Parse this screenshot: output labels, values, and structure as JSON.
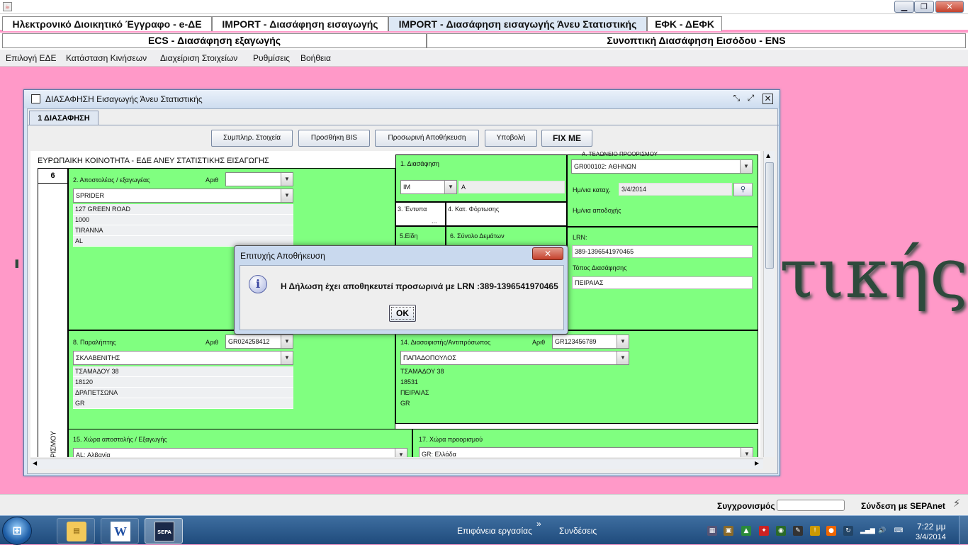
{
  "app": {
    "tabs_row1": [
      "Ηλεκτρονικό Διοικητικό Έγγραφο - e-ΔΕ",
      "IMPORT - Διασάφηση εισαγωγής",
      "IMPORT - Διασάφηση εισαγωγής Άνευ Στατιστικής",
      "ΕΦΚ - ΔΕΦΚ"
    ],
    "tabs_row2": [
      "ECS - Διασάφηση εξαγωγής",
      "Συνοπτική Διασάφηση Εισόδου - ENS"
    ],
    "selected_tab": "IMPORT - Διασάφηση εισαγωγής Άνευ Στατιστικής",
    "menu": [
      "Επιλογή ΕΔΕ",
      "Κατάσταση Κινήσεων",
      "Διαχείριση Στοιχείων",
      "Ρυθμίσεις",
      "Βοήθεια"
    ],
    "window_controls": [
      "minimize-icon",
      "restore-icon",
      "close-icon"
    ]
  },
  "background_word": "τικής",
  "frame": {
    "title": "ΔΙΑΣΑΦΗΣΗ Εισαγωγής Άνευ Στατιστικής",
    "tab": "1 ΔΙΑΣΑΦΗΣΗ",
    "buttons": [
      "Συμπληρ. Στοιχεία",
      "Προσθήκη BIS",
      "Προσωρινή Αποθήκευση",
      "Υποβολή",
      "FIX ME"
    ]
  },
  "form": {
    "header": "ΕΥΡΩΠΑΙΚΗ ΚΟΙΝΟΤΗΤΑ - ΕΔΕ ΑΝΕΥ ΣΤΑΤΙΣΤΙΚΗΣ ΕΙΣΑΓΩΓΗΣ",
    "col_number": "6",
    "side_label": "Α ΠΡΟΟΡΙΣΜΟΥ",
    "top_cut_label": "Α. ΤΕΛΩΝΕΙΟ ΠΡΟΟΡΙΣΜΟΥ",
    "box2": {
      "label": "2. Αποστολέας / εξαγωγέας",
      "arith": "Αριθ",
      "arith_value": "",
      "name": "SPRIDER",
      "lines": [
        "127 GREEN ROAD",
        "1000",
        "TIRANNA",
        "AL"
      ]
    },
    "box1": {
      "label": "1. Διασάφηση",
      "type": "IM",
      "sub": "A"
    },
    "box3": {
      "label": "3. Έντυπα",
      "value": "..."
    },
    "box4": {
      "label": "4. Κατ. Φόρτωσης"
    },
    "box5": {
      "label": "5.Είδη"
    },
    "box6": {
      "label": "6. Σύνολο Δεμάτων"
    },
    "boxA": {
      "office": "GR000102: ΑΘΗΝΩΝ",
      "date_label": "Ημ/νια καταχ.",
      "date_value": "3/4/2014",
      "accept_label": "Ημ/νια αποδοχής"
    },
    "lrn": {
      "label": "LRN:",
      "value": "389-1396541970465",
      "place_label": "Τόπος Διασάφησης",
      "place_value": "ΠΕΙΡΑΙΑΣ"
    },
    "box8": {
      "label": "8. Παραλήπτης",
      "arith": "Αριθ",
      "arith_value": "GR024258412",
      "name": "ΣΚΛΑΒΕΝΙΤΗΣ",
      "lines": [
        "ΤΣΑΜΑΔΟΥ 38",
        "18120",
        "ΔΡΑΠΕΤΣΩΝΑ",
        "GR"
      ]
    },
    "box14": {
      "label": "14. Διασαφιστής/Αντιπρόσωπος",
      "arith": "Αριθ",
      "arith_value": "GR123456789",
      "name": "ΠΑΠΑΔΟΠΟΥΛΟΣ",
      "lines": [
        "ΤΣΑΜΑΔΟΥ 38",
        "18531",
        "ΠΕΙΡΑΙΑΣ",
        "GR"
      ]
    },
    "box15": {
      "label": "15. Χώρα αποστολής / Εξαγωγής",
      "value": "AL: Αλβανία"
    },
    "box17": {
      "label": "17. Χώρα προορισμού",
      "value": "GR: Ελλάδα"
    }
  },
  "dialog": {
    "title": "Επιτυχής Αποθήκευση",
    "icon": "info-icon",
    "message": "Η Δήλωση έχει αποθηκευτεί προσωρινά με LRN :389-1396541970465",
    "ok": "OK"
  },
  "status": {
    "sync_label": "Συγχρονισμός",
    "sepa_label": "Σύνδεση με SEPAnet"
  },
  "taskbar": {
    "desktop_label": "Επιφάνεια εργασίας",
    "chevron": "»",
    "connections_label": "Συνδέσεις",
    "time": "7:22 μμ",
    "date": "3/4/2014",
    "apps": [
      "explorer-icon",
      "word-icon",
      "sepa-desktop-icon"
    ],
    "word_glyph": "W",
    "sepa_glyph": "SEPA"
  }
}
